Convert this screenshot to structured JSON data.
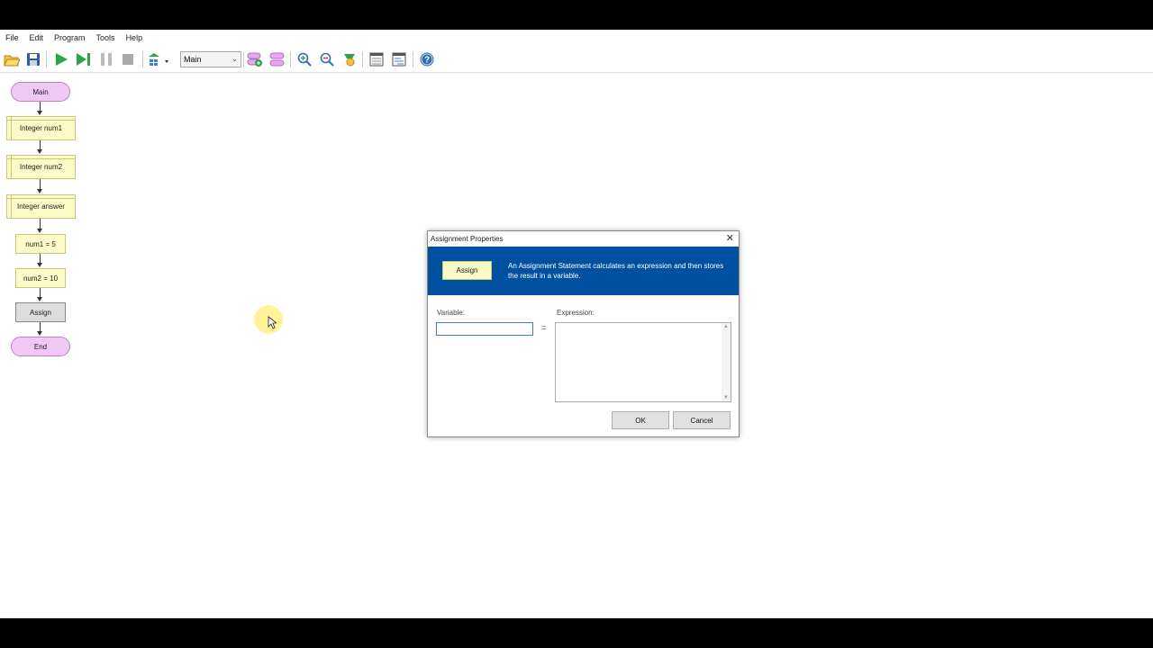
{
  "menu": [
    "File",
    "Edit",
    "Program",
    "Tools",
    "Help"
  ],
  "toolbar": {
    "subchart_select": "Main",
    "icons": [
      "open-icon",
      "save-icon",
      "run-icon",
      "step-icon",
      "pause-icon",
      "stop-icon",
      "layout-icon",
      "add-function-icon",
      "remove-function-icon",
      "zoom-in-icon",
      "zoom-out-icon",
      "zoom-fit-icon",
      "variables-window-icon",
      "console-window-icon",
      "help-icon"
    ]
  },
  "flowchart": {
    "start": "Main",
    "declarations": [
      "Integer num1",
      "Integer num2",
      "Integer answer"
    ],
    "assignments": [
      "num1 = 5",
      "num2 = 10"
    ],
    "selected": "Assign",
    "end": "End"
  },
  "dialog": {
    "title": "Assignment Properties",
    "banner_shape": "Assign",
    "banner_text": "An Assignment Statement calculates an expression and then stores the result in a variable.",
    "variable_label": "Variable:",
    "variable_value": "",
    "equals": "=",
    "expression_label": "Expression:",
    "expression_value": "",
    "ok": "OK",
    "cancel": "Cancel",
    "close_glyph": "✕"
  },
  "colors": {
    "banner": "#0050a0",
    "terminal": "#f0c8f4",
    "statement": "#fbfbc8",
    "run": "#2ca44a"
  }
}
